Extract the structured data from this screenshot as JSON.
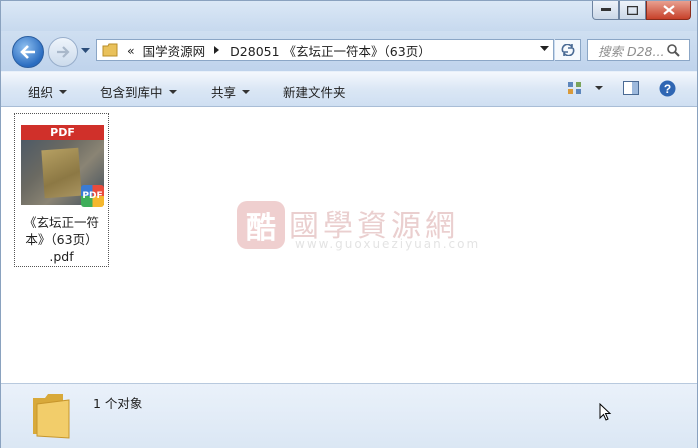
{
  "address": {
    "history_marker": "«",
    "crumbs": [
      "国学资源网",
      "D28051 《玄坛正一符本》（63页）"
    ]
  },
  "search": {
    "placeholder": "搜索 D28..."
  },
  "toolbar": {
    "organize": "组织",
    "include_library": "包含到库中",
    "share": "共享",
    "new_folder": "新建文件夹"
  },
  "file": {
    "thumb_label": "PDF",
    "badge_label": "PDF",
    "name_line1": "《玄坛正一符",
    "name_line2": "本》（63页）",
    "name_line3": ".pdf"
  },
  "watermark": {
    "logo": "酷",
    "title": "國學資源網",
    "url": "www.guoxueziyuan.com"
  },
  "status": {
    "count_text": "1 个对象"
  },
  "colors": {
    "accent": "#2a6cc0",
    "pdf_red": "#d0302a",
    "close_red": "#c7412a"
  }
}
